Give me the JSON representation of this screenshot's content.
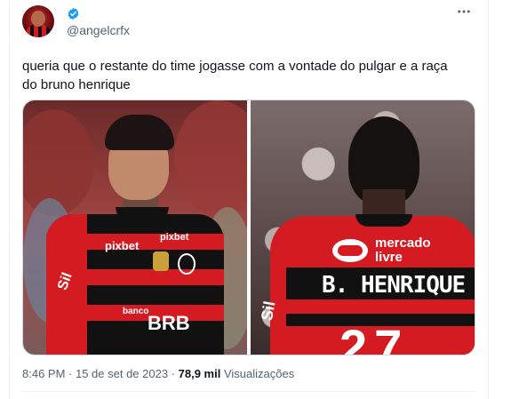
{
  "tweet": {
    "handle": "@angelcrfx",
    "verified_icon": "verified-badge-icon",
    "more_icon": "more-options-icon",
    "text_line1": "queria que o restante do time jogasse com a vontade do pulgar e a raça",
    "text_line2": "do bruno henrique",
    "timestamp": "8:46 PM · 15 de set de 2023 ·",
    "views_count": "78,9 mil",
    "views_label": "Visualizações"
  },
  "media": {
    "left_jersey": {
      "sponsor": "pixbet",
      "sponsor2": "pixbet",
      "sleeve": "Sil",
      "bank_label": "banco",
      "bank_name": "BRB"
    },
    "right_jersey": {
      "sponsor_line1": "mercado",
      "sponsor_line2": "livre",
      "sleeve": "Sil",
      "player_name": "B. HENRIQUE",
      "number": "27"
    }
  },
  "colors": {
    "text_primary": "#0f1419",
    "text_secondary": "#536471",
    "verified_blue": "#1d9bf0",
    "flamengo_red": "#d41b22",
    "flamengo_black": "#111111"
  }
}
